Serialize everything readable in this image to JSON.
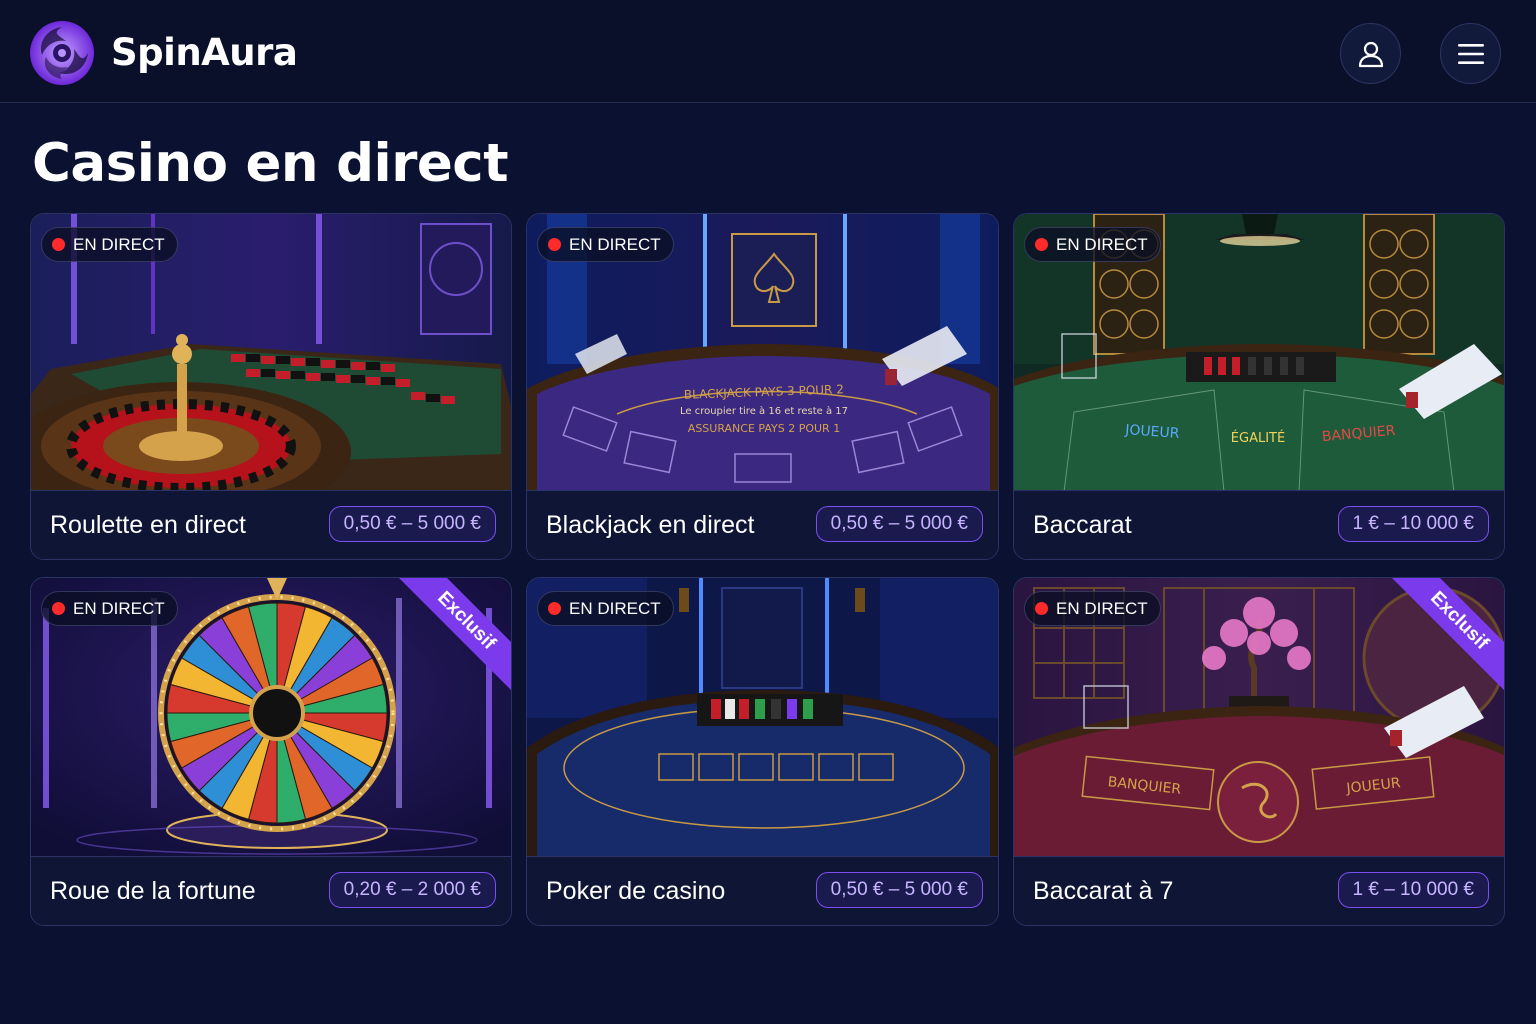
{
  "app": {
    "brand": "SpinAura",
    "logo_icon": "swirl-logo-icon",
    "accent_color": "#7c3aed"
  },
  "header": {
    "user_icon": "user-icon",
    "menu_icon": "hamburger-menu-icon"
  },
  "page": {
    "title": "Casino en direct"
  },
  "games": [
    {
      "name": "Roulette en direct",
      "limits": "0,50 € – 5 000 €",
      "live_label": "EN DIRECT",
      "exclusive": false,
      "scene": "roulette-table"
    },
    {
      "name": "Blackjack en direct",
      "limits": "0,50 € – 5 000 €",
      "live_label": "EN DIRECT",
      "exclusive": false,
      "scene": "blackjack-table",
      "table_text": [
        "BLACKJACK PAYS 3 POUR 2",
        "Le croupier tire à 16 et reste à 17",
        "ASSURANCE PAYS 2 POUR 1"
      ]
    },
    {
      "name": "Baccarat",
      "limits": "1 € – 10 000 €",
      "live_label": "EN DIRECT",
      "exclusive": false,
      "scene": "baccarat-table",
      "table_text": [
        "JOUEUR",
        "ÉGALITÉ",
        "BANQUIER"
      ]
    },
    {
      "name": "Roue de la fortune",
      "limits": "0,20 € – 2 000 €",
      "live_label": "EN DIRECT",
      "exclusive": true,
      "exclusive_label": "Exclusif",
      "scene": "fortune-wheel"
    },
    {
      "name": "Poker de casino",
      "limits": "0,50 € – 5 000 €",
      "live_label": "EN DIRECT",
      "exclusive": false,
      "scene": "poker-table"
    },
    {
      "name": "Baccarat à 7",
      "limits": "1 € – 10 000 €",
      "live_label": "EN DIRECT",
      "exclusive": true,
      "exclusive_label": "Exclusif",
      "scene": "baccarat-7-table",
      "table_text": [
        "BANQUIER",
        "JOUEUR"
      ]
    }
  ]
}
